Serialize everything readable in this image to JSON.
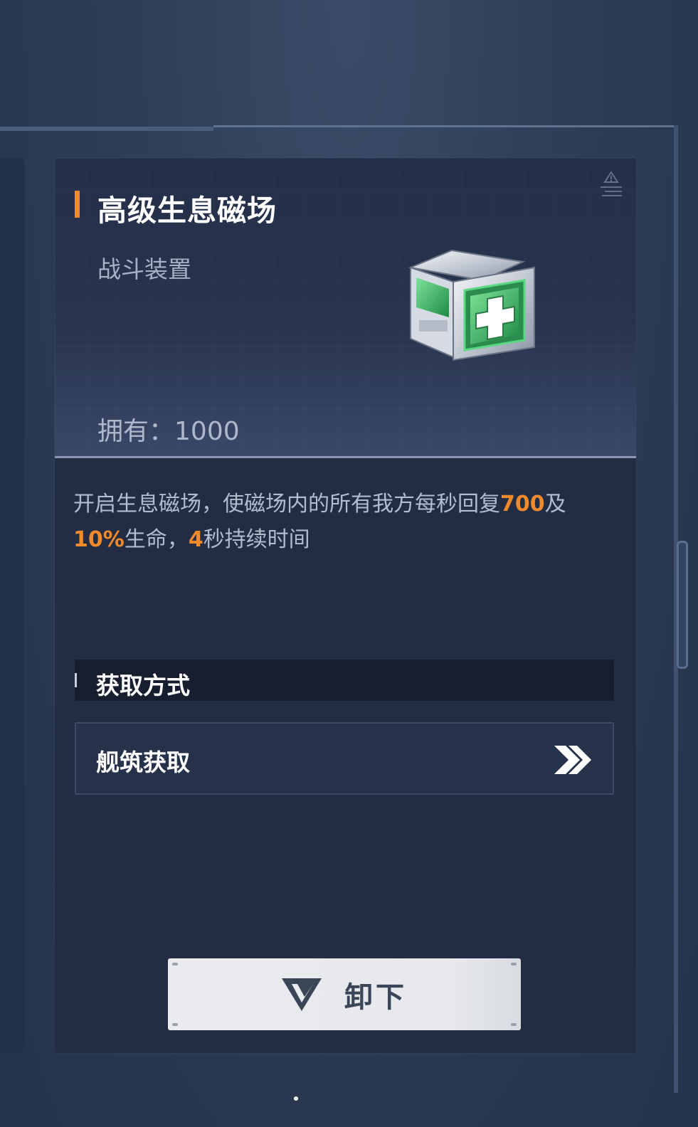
{
  "item": {
    "name": "高级生息磁场",
    "category": "战斗装置",
    "owned_label": "拥有：",
    "owned_value": "1000",
    "icon": "medkit-box-icon"
  },
  "description": {
    "part1": "开启生息磁场，使磁场内的所有我方每秒回复",
    "value1": "700",
    "part2": "及",
    "value2": "10%",
    "part3": "生命，",
    "value3": "4",
    "part4": "秒持续时间"
  },
  "acquire": {
    "section_title": "获取方式",
    "sources": [
      {
        "label": "舰筑获取",
        "icon": "double-chevron-right-icon"
      }
    ]
  },
  "actions": {
    "unequip_label": "卸下",
    "unequip_icon": "triangle-logo-icon"
  },
  "colors": {
    "accent": "#f08a2a",
    "card_bg": "#222d44",
    "button_bg": "#e9ebee"
  }
}
